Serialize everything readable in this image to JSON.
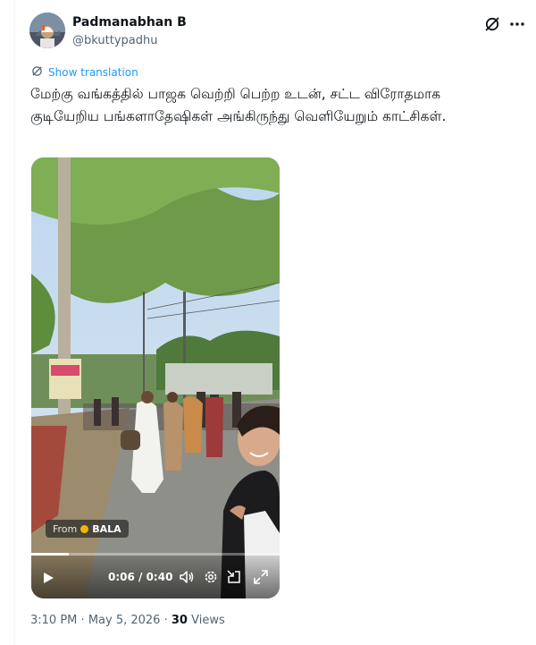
{
  "user": {
    "display_name": "Padmanabhan B",
    "handle": "@bkuttypadhu"
  },
  "translate": {
    "label": "Show translation"
  },
  "tweet": {
    "text": "மேற்கு வங்கத்தில் பாஜக வெற்றி பெற்ற உடன், சட்ட விரோதமாக குடியேறிய பங்களாதேஷிகள் அங்கிருந்து வெளியேறும் காட்சிகள்."
  },
  "video": {
    "from_label": "From",
    "from_name": "BALA",
    "current_time": "0:06",
    "duration": "0:40",
    "time_display": "0:06 / 0:40",
    "progress": 0.15
  },
  "meta": {
    "time": "3:10 PM",
    "separator": "·",
    "date": "May 5, 2026",
    "views_count": "30",
    "views_label": "Views"
  },
  "icons": {
    "grok": "grok-icon",
    "more": "more-icon",
    "translate": "translate-icon",
    "play": "play-icon",
    "volume": "volume-icon",
    "settings": "settings-icon",
    "dock": "dock-icon",
    "fullscreen": "fullscreen-icon"
  },
  "colors": {
    "link": "#1d9bf0",
    "secondary_text": "#536471",
    "primary_text": "#0f1419"
  }
}
